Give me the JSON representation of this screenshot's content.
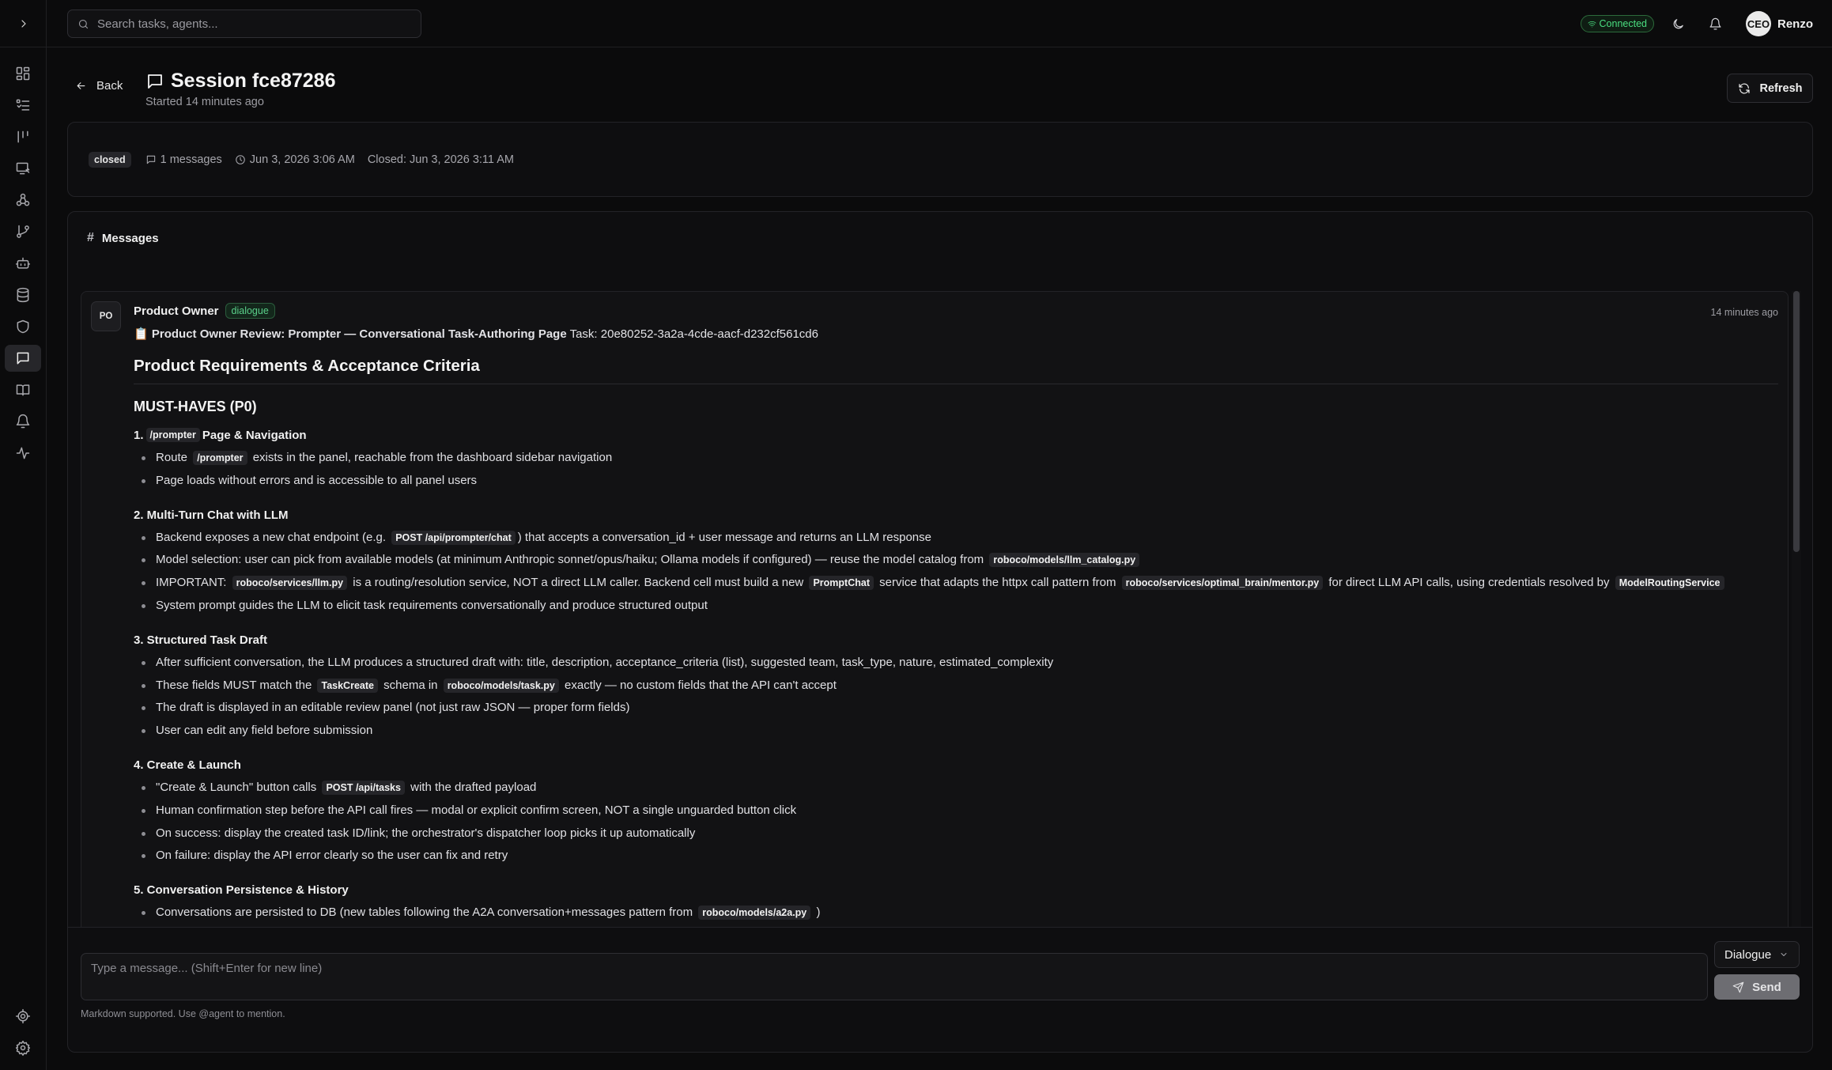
{
  "search": {
    "placeholder": "Search tasks, agents..."
  },
  "topbar": {
    "connection_status": "Connected",
    "avatar_initials": "CEO",
    "user_name": "Renzo"
  },
  "header": {
    "back_label": "Back",
    "title": "Session fce87286",
    "subtitle": "Started 14 minutes ago",
    "refresh_label": "Refresh"
  },
  "meta": {
    "status": "closed",
    "messages_count": "1 messages",
    "started_at": "Jun 3, 2026 3:06 AM",
    "closed_at": "Closed: Jun 3, 2026 3:11 AM"
  },
  "messages_panel": {
    "title": "Messages"
  },
  "message": {
    "avatar": "PO",
    "sender": "Product Owner",
    "badge": "dialogue",
    "time": "14 minutes ago",
    "review_emoji": "📋",
    "review_title": "Product Owner Review: Prompter — Conversational Task-Authoring Page",
    "review_task": " Task: 20e80252-3a2a-4cde-aacf-d232cf561cd6",
    "h2": "Product Requirements & Acceptance Criteria",
    "h3": "MUST-HAVES (P0)",
    "s1": {
      "num": "1.",
      "code": "/prompter",
      "title": "Page & Navigation",
      "i1a": "Route",
      "i1code": "/prompter",
      "i1b": "exists in the panel, reachable from the dashboard sidebar navigation",
      "i2": "Page loads without errors and is accessible to all panel users"
    },
    "s2": {
      "title": "2. Multi-Turn Chat with LLM",
      "i1a": "Backend exposes a new chat endpoint (e.g.",
      "i1code": "POST /api/prompter/chat",
      "i1b": ") that accepts a conversation_id + user message and returns an LLM response",
      "i2a": "Model selection: user can pick from available models (at minimum Anthropic sonnet/opus/haiku; Ollama models if configured) — reuse the model catalog from",
      "i2code": "roboco/models/llm_catalog.py",
      "i3a": "IMPORTANT:",
      "i3code1": "roboco/services/llm.py",
      "i3b": "is a routing/resolution service, NOT a direct LLM caller. Backend cell must build a new",
      "i3code2": "PromptChat",
      "i3c": "service that adapts the httpx call pattern from",
      "i3code3": "roboco/services/optimal_brain/mentor.py",
      "i3d": "for direct LLM API calls, using credentials resolved by",
      "i3code4": "ModelRoutingService",
      "i4": "System prompt guides the LLM to elicit task requirements conversationally and produce structured output"
    },
    "s3": {
      "title": "3. Structured Task Draft",
      "i1": "After sufficient conversation, the LLM produces a structured draft with: title, description, acceptance_criteria (list), suggested team, task_type, nature, estimated_complexity",
      "i2a": "These fields MUST match the",
      "i2code1": "TaskCreate",
      "i2b": "schema in",
      "i2code2": "roboco/models/task.py",
      "i2c": "exactly — no custom fields that the API can't accept",
      "i3": "The draft is displayed in an editable review panel (not just raw JSON — proper form fields)",
      "i4": "User can edit any field before submission"
    },
    "s4": {
      "title": "4. Create & Launch",
      "i1a": "\"Create & Launch\" button calls",
      "i1code": "POST /api/tasks",
      "i1b": "with the drafted payload",
      "i2": "Human confirmation step before the API call fires — modal or explicit confirm screen, NOT a single unguarded button click",
      "i3": "On success: display the created task ID/link; the orchestrator's dispatcher loop picks it up automatically",
      "i4": "On failure: display the API error clearly so the user can fix and retry"
    },
    "s5": {
      "title": "5. Conversation Persistence & History",
      "i1a": "Conversations are persisted to DB (new tables following the A2A conversation+messages pattern from",
      "i1code": "roboco/models/a2a.py",
      "i1b": ")"
    }
  },
  "composer": {
    "placeholder": "Type a message... (Shift+Enter for new line)",
    "mode": "Dialogue",
    "send_label": "Send",
    "hint": "Markdown supported. Use @agent to mention."
  }
}
